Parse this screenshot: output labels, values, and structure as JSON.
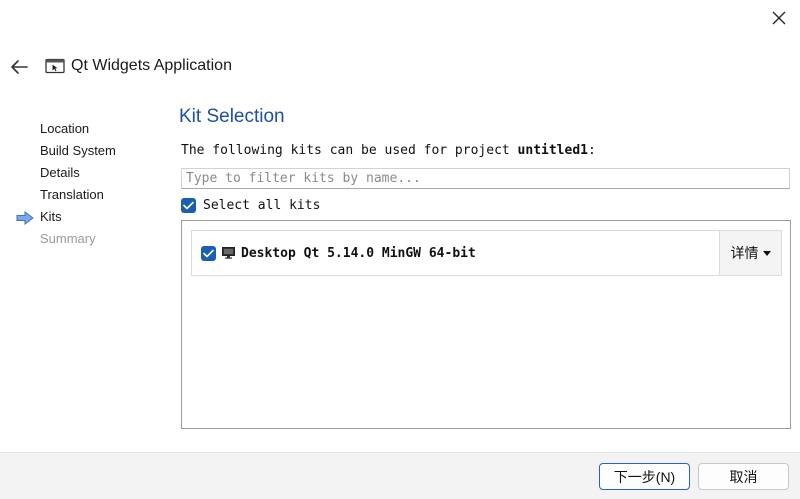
{
  "window": {
    "title": "Qt Widgets Application"
  },
  "steps": [
    {
      "label": "Location",
      "state": "done"
    },
    {
      "label": "Build System",
      "state": "done"
    },
    {
      "label": "Details",
      "state": "done"
    },
    {
      "label": "Translation",
      "state": "done"
    },
    {
      "label": "Kits",
      "state": "current"
    },
    {
      "label": "Summary",
      "state": "disabled"
    }
  ],
  "page": {
    "title": "Kit Selection",
    "intro_prefix": "The following kits can be used for project ",
    "project_name": "untitled1",
    "intro_suffix": ":"
  },
  "filter": {
    "placeholder": "Type to filter kits by name...",
    "value": ""
  },
  "select_all": {
    "label": "Select all kits",
    "checked": true
  },
  "kits": [
    {
      "name": "Desktop Qt 5.14.0 MinGW 64-bit",
      "checked": true,
      "details_label": "详情"
    }
  ],
  "footer": {
    "next_label": "下一步(N)",
    "cancel_label": "取消"
  },
  "colors": {
    "accent": "#1a5fb4",
    "title": "#1f4fa3",
    "disabled_text": "#9a9a9a"
  },
  "icons": {
    "close": "close-icon",
    "back": "back-arrow-icon",
    "app": "qt-widgets-app-icon",
    "current_step": "arrow-right-icon",
    "kit": "monitor-icon",
    "dropdown": "chevron-down-icon"
  }
}
